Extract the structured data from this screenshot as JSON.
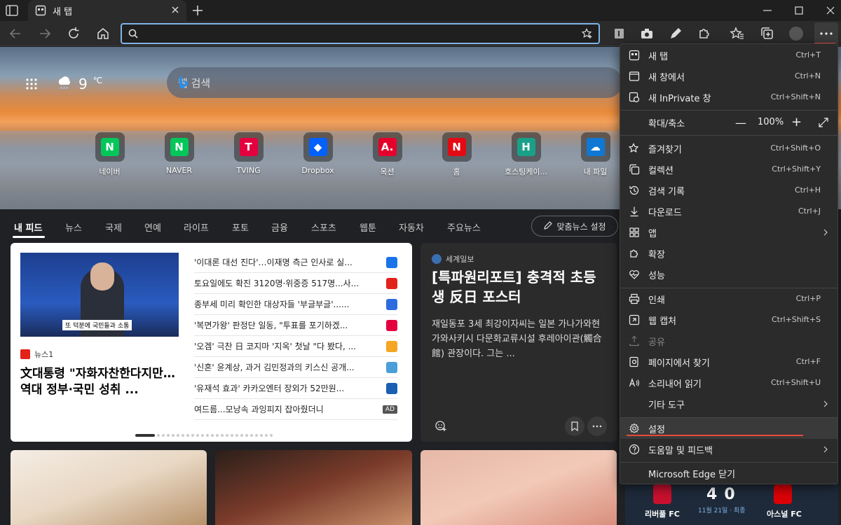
{
  "tab": {
    "title": "새 탭"
  },
  "address": {
    "value": ""
  },
  "hero": {
    "temperature": "9",
    "temp_unit": "℃",
    "search_placeholder": "웹 검색"
  },
  "quicklinks": [
    {
      "label": "네이버",
      "glyph": "N",
      "color": "#03c75a"
    },
    {
      "label": "NAVER",
      "glyph": "N",
      "color": "#03c75a"
    },
    {
      "label": "TVING",
      "glyph": "T",
      "color": "#e4003f"
    },
    {
      "label": "Dropbox",
      "glyph": "◆",
      "color": "#0061fe"
    },
    {
      "label": "옥션",
      "glyph": "A.",
      "color": "#e5002b"
    },
    {
      "label": "홈",
      "glyph": "N",
      "color": "#e50914"
    },
    {
      "label": "호스팅케이...",
      "glyph": "H",
      "color": "#1aa089"
    },
    {
      "label": "내 파일",
      "glyph": "☁",
      "color": "#0f78d4"
    }
  ],
  "feed_nav": {
    "items": [
      "내 피드",
      "뉴스",
      "국제",
      "연예",
      "라이프",
      "포토",
      "금융",
      "스포츠",
      "웹툰",
      "자동차",
      "주요뉴스"
    ],
    "personalize": "맞춤뉴스 설정"
  },
  "card1": {
    "photo_caption": "또 덕분에 국민들과 소통",
    "source": "뉴스1",
    "headline": "文대통령 \"자화자찬한다지만…역대 정부·국민 성취 ...",
    "list": [
      {
        "text": "'이대론 대선 진다'…이재명 측근 인사로 실...",
        "color": "#1a73e8"
      },
      {
        "text": "토요일에도 확진 3120명·위중증 517명...사...",
        "color": "#e2231a"
      },
      {
        "text": "종부세 미리 확인한 대상자들 '부글부글'......",
        "color": "#2d6cdf"
      },
      {
        "text": "'복면가왕' 판정단 일동, \"투표를 포기하겠...",
        "color": "#e4003f"
      },
      {
        "text": "'오겜' 극찬 日 코지마 '지옥' 첫날 \"다 봤다, ...",
        "color": "#f5a623"
      },
      {
        "text": "'신혼' 윤계상, 과거 김민정과의 키스신 공개...",
        "color": "#4a9fd8"
      },
      {
        "text": "'유재석 효과' 카카오엔터 장외가 52만원...",
        "color": "#1a5fb4"
      },
      {
        "text": "여드름...모낭속 과잉피지 잡아줬더니",
        "ad": "AD"
      }
    ]
  },
  "card2": {
    "source": "세계일보",
    "headline": "[특파원리포트] 충격적 초등생 反日 포스터",
    "description": "재일동포 3세 최강이자씨는 일본 가나가와현 가와사키시 다문화교류시설 후레아이관(觸合館) 관장이다. 그는 ..."
  },
  "score": {
    "home": "리버풀 FC",
    "away": "아스널 FC",
    "home_goals": "4",
    "away_goals": "0",
    "date": "11월 21일 · 최종"
  },
  "menu": {
    "new_tab": {
      "label": "새 탭",
      "shortcut": "Ctrl+T"
    },
    "new_window": {
      "label": "새 창에서",
      "shortcut": "Ctrl+N"
    },
    "new_inprivate": {
      "label": "새 InPrivate 창",
      "shortcut": "Ctrl+Shift+N"
    },
    "zoom": {
      "label": "확대/축소",
      "value": "100%",
      "minus": "—",
      "plus": "+"
    },
    "favorites": {
      "label": "즐겨찾기",
      "shortcut": "Ctrl+Shift+O"
    },
    "collections": {
      "label": "컬렉션",
      "shortcut": "Ctrl+Shift+Y"
    },
    "history": {
      "label": "검색 기록",
      "shortcut": "Ctrl+H"
    },
    "downloads": {
      "label": "다운로드",
      "shortcut": "Ctrl+J"
    },
    "apps": {
      "label": "앱"
    },
    "extensions": {
      "label": "확장"
    },
    "performance": {
      "label": "성능"
    },
    "print": {
      "label": "인쇄",
      "shortcut": "Ctrl+P"
    },
    "web_capture": {
      "label": "웹 캡처",
      "shortcut": "Ctrl+Shift+S"
    },
    "share": {
      "label": "공유"
    },
    "find": {
      "label": "페이지에서 찾기",
      "shortcut": "Ctrl+F"
    },
    "read_aloud": {
      "label": "소리내어 읽기",
      "shortcut": "Ctrl+Shift+U"
    },
    "more_tools": {
      "label": "기타 도구"
    },
    "settings": {
      "label": "설정"
    },
    "help": {
      "label": "도움말 및 피드백"
    },
    "close": {
      "label": "Microsoft Edge 닫기"
    }
  },
  "colors": {
    "accent": "#7fb3e6",
    "highlight_underline": "#e64a3b"
  }
}
